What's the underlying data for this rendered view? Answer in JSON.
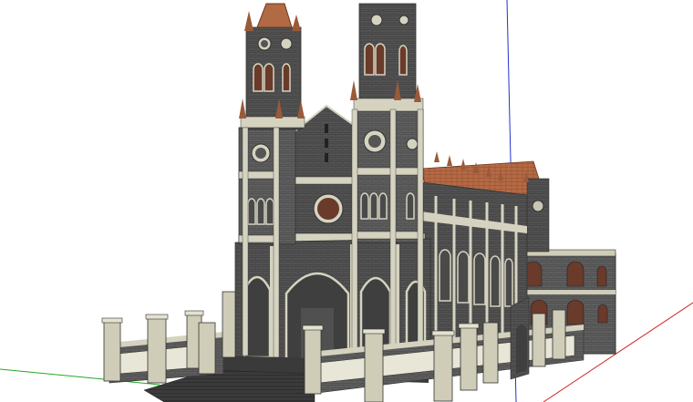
{
  "viewport": {
    "model": "gothic-cathedral-3d-model",
    "axes": {
      "red": "#d02020",
      "green": "#22aa22",
      "blue": "#2233cc"
    },
    "colors": {
      "background": "#ffffff",
      "stone_dark": "#4a4a4a",
      "stone_mid": "#5c5c5c",
      "stone_light": "#d8d6c4",
      "roof_tile": "#b86a44",
      "spire": "#9a5a38",
      "window_glass": "#6a3a2a"
    }
  }
}
